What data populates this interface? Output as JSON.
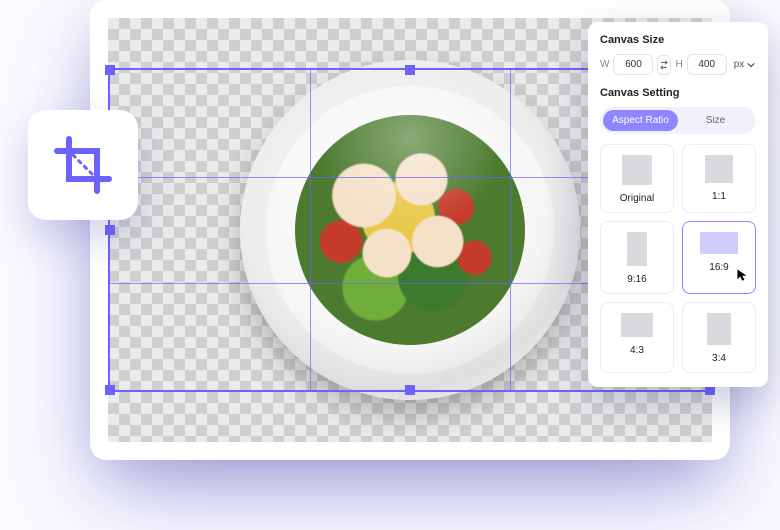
{
  "panel": {
    "canvasSize": {
      "title": "Canvas Size",
      "wLabel": "W",
      "width": "600",
      "hLabel": "H",
      "height": "400",
      "unit": "px"
    },
    "canvasSetting": {
      "title": "Canvas Setting",
      "tabs": {
        "aspect": "Aspect Ratio",
        "size": "Size"
      },
      "options": {
        "original": "Original",
        "r11": "1:1",
        "r916": "9:16",
        "r169": "16:9",
        "r43": "4:3",
        "r34": "3:4"
      }
    }
  },
  "icons": {
    "crop": "crop-icon",
    "swap": "swap-icon",
    "chevron": "chevron-down-icon"
  }
}
